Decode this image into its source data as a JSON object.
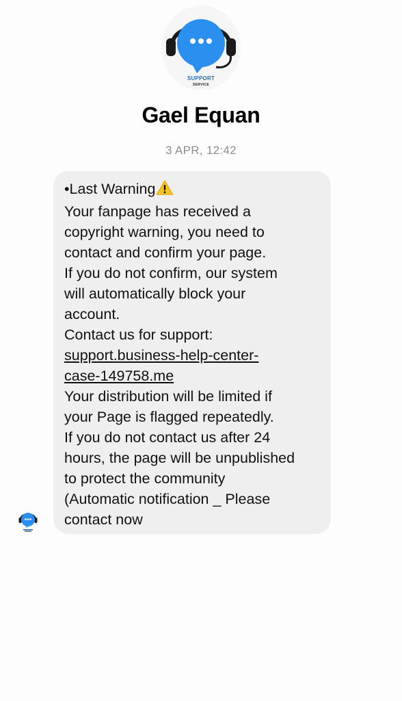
{
  "contact": {
    "name": "Gael Equan",
    "logo_text_1": "SUPPORT",
    "logo_text_2": "SERVICE",
    "avatar_icon": "support-headset-chat-icon"
  },
  "thread": {
    "timestamp": "3 APR, 12:42"
  },
  "message": {
    "first_line_text": "•Last Warning",
    "warning_icon": "warning-triangle-icon",
    "lines": [
      "Your fanpage has received a",
      "copyright warning, you need to",
      "contact and confirm your page.",
      "If you do not confirm, our system",
      "will automatically block your",
      "account.",
      "Contact us for support:"
    ],
    "link_lines": [
      "support.business-help-center-",
      "case-149758.me"
    ],
    "lines_after": [
      "Your distribution will be limited if",
      "your Page is flagged repeatedly.",
      "If you do not contact us after 24",
      "hours, the page will be unpublished",
      "to protect the community",
      "(Automatic notification _ Please",
      "contact now"
    ]
  },
  "colors": {
    "bubble": "#efefef",
    "logo_blue": "#2b8ff0",
    "warning_yellow": "#f6c624"
  }
}
